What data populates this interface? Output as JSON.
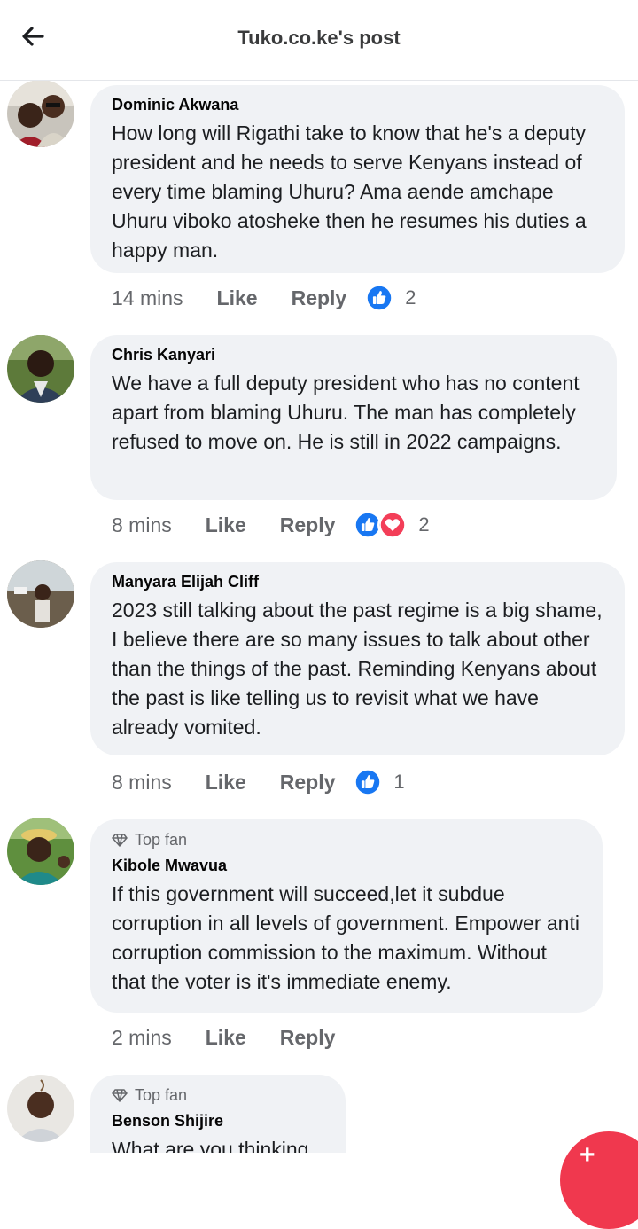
{
  "header": {
    "title": "Tuko.co.ke's post",
    "back_icon": "arrow-left-icon"
  },
  "comments": [
    {
      "author": "Dominic Akwana",
      "text": "How long will Rigathi take to know that he's a deputy president and he needs to serve Kenyans instead of every time blaming Uhuru? Ama aende amchape Uhuru viboko atosheke then he resumes his duties a happy man.",
      "time": "14 mins",
      "like": "Like",
      "reply": "Reply",
      "reactions": [
        "like"
      ],
      "reaction_count": "2"
    },
    {
      "author": "Chris Kanyari",
      "text": "We have a full deputy president who has no content apart from blaming Uhuru. The man has completely refused to move on. He is still in 2022 campaigns.",
      "time": "8 mins",
      "like": "Like",
      "reply": "Reply",
      "reactions": [
        "like",
        "love"
      ],
      "reaction_count": "2"
    },
    {
      "author": "Manyara Elijah Cliff",
      "text": "2023 still talking about the past regime is a big shame, I believe there are so many issues to talk about other than the things of the past. Reminding Kenyans about the past is like telling us to revisit what we have already vomited.",
      "time": "8 mins",
      "like": "Like",
      "reply": "Reply",
      "reactions": [
        "like"
      ],
      "reaction_count": "1"
    },
    {
      "badge": "Top fan",
      "author": "Kibole Mwavua",
      "text": "If this government will succeed,let it subdue corruption in all levels of government. Empower anti corruption commission to the maximum. Without that the voter is it's immediate enemy.",
      "time": "2 mins",
      "like": "Like",
      "reply": "Reply"
    },
    {
      "badge": "Top fan",
      "author": "Benson Shijire",
      "text": "What are you thinking"
    }
  ],
  "colors": {
    "like_blue": "#1877f2",
    "love_red": "#f33e58",
    "bubble_bg": "#f0f2f5",
    "fab_red": "#f0384e"
  }
}
